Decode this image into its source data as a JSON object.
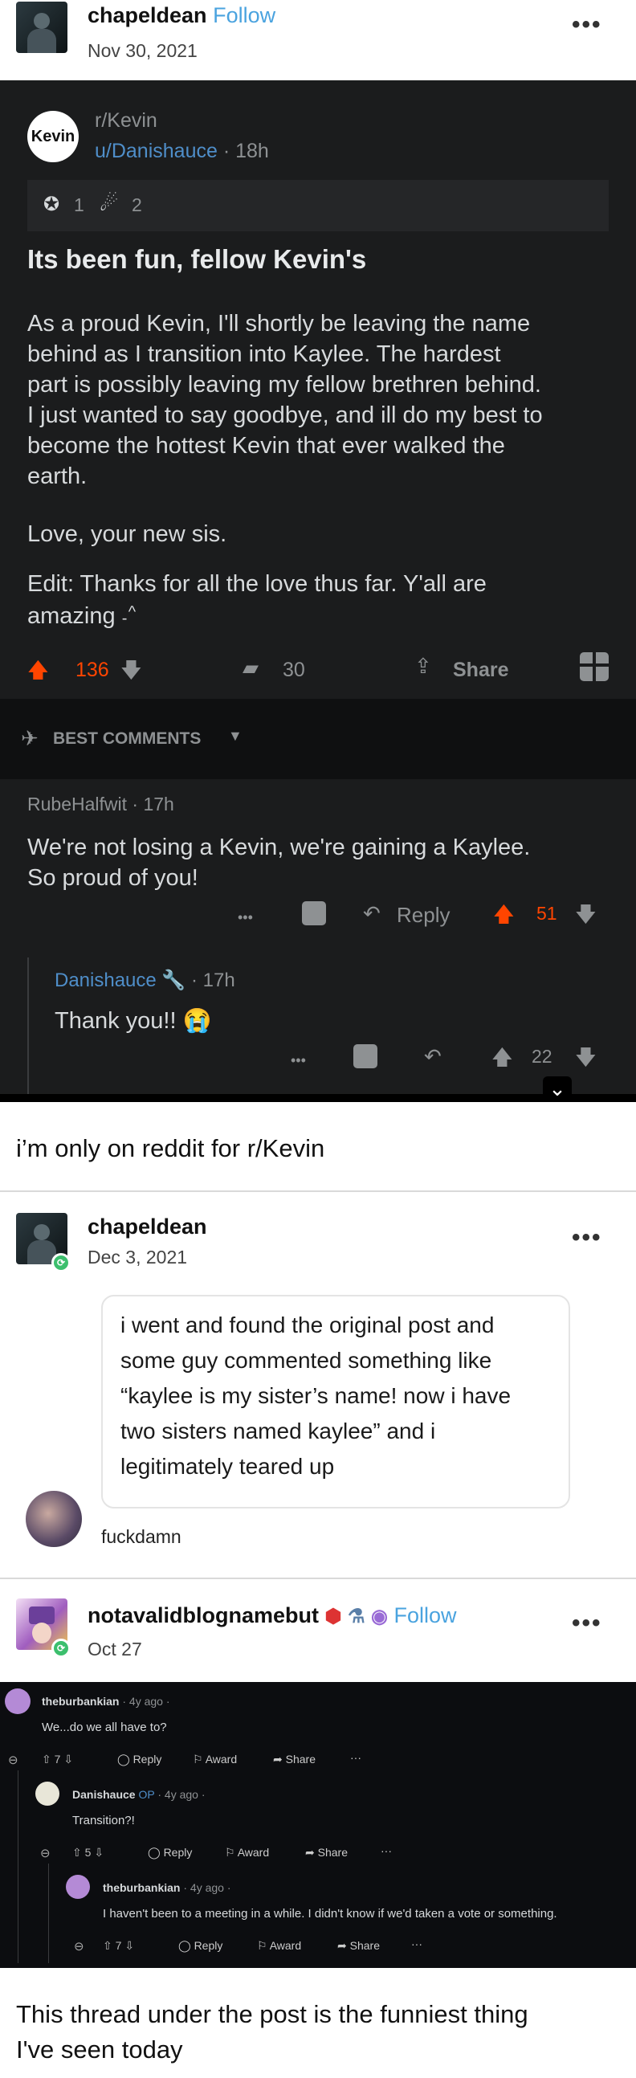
{
  "post1": {
    "username": "chapeldean",
    "follow": "Follow",
    "date": "Nov 30, 2021",
    "more": "•••",
    "screenshot": {
      "subreddit": "r/Kevin",
      "avatar_text": "Kevin",
      "author": "u/Danishauce",
      "time": "· 18h",
      "award1_count": "1",
      "award2_count": "2",
      "title": "Its been fun, fellow Kevin's",
      "body_lines": [
        "As a proud Kevin, I'll shortly be leaving the name",
        "behind as I transition into Kaylee. The hardest",
        "part is possibly leaving my fellow brethren behind.",
        "I just wanted to say goodbye, and ill do my best to",
        "become the hottest Kevin that ever walked the",
        "earth."
      ],
      "signoff": "Love, your new sis.",
      "edit_line1": "Edit: Thanks for all the love thus far. Y'all are",
      "edit_line2": "amazing",
      "emote_caret": "^",
      "emote_dash": "-",
      "upvotes": "136",
      "comments": "30",
      "share": "Share",
      "best_comments": "BEST COMMENTS",
      "comment1": {
        "author": "RubeHalfwit",
        "time": "· 17h",
        "line1": "We're not losing a Kevin, we're gaining a Kaylee.",
        "line2": "So proud of you!",
        "dots": "•••",
        "reply": "Reply",
        "votes": "51"
      },
      "comment2": {
        "author": "Danishauce",
        "time": "· 17h",
        "text": "Thank you!!",
        "emoji": "😭",
        "dots": "•••",
        "votes": "22"
      }
    },
    "caption": "i’m only on reddit for r/Kevin"
  },
  "post2": {
    "username": "chapeldean",
    "date": "Dec 3, 2021",
    "more": "•••",
    "ask_lines": [
      "i went and found the original post and",
      "some guy commented something like",
      "“kaylee is my sister’s name! now i have",
      "two sisters named kaylee” and i",
      "legitimately teared up"
    ],
    "asker": "fuckdamn"
  },
  "post3": {
    "username": "notavalidblognamebut",
    "follow": "Follow",
    "date": "Oct 27",
    "more": "•••",
    "thread": {
      "c1": {
        "author": "theburbankian",
        "time": "· 4y ago ·",
        "text": "We...do we all have to?",
        "votes": "7"
      },
      "c2": {
        "author": "Danishauce",
        "op": "OP",
        "time": "· 4y ago ·",
        "text": "Transition?!",
        "votes": "5"
      },
      "c3": {
        "author": "theburbankian",
        "time": "· 4y ago ·",
        "text": "I haven't been to a meeting in a while. I didn't know if we'd taken a vote or something.",
        "votes": "7"
      },
      "reply": "Reply",
      "award": "Award",
      "share": "Share",
      "dots": "···",
      "collapse": "⊖"
    },
    "caption_line1": "This thread under the post is the funniest thing",
    "caption_line2": "I've seen today"
  },
  "colors": {
    "follow": "#4aa3df",
    "upvote": "#ff4500",
    "reblog": "#3cbf6d",
    "reddit_dark": "#1b1c1d"
  }
}
